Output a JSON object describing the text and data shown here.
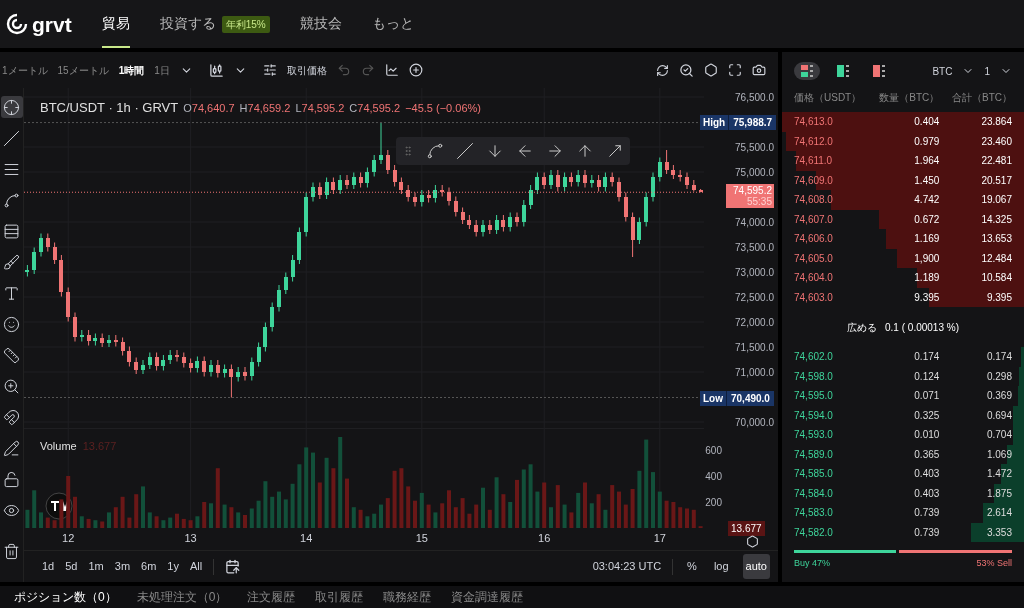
{
  "nav": {
    "logo": "grvt",
    "items": [
      {
        "label": "貿易",
        "selected": true
      },
      {
        "label": "投資する",
        "selected": false,
        "badge": "年利15%"
      },
      {
        "label": "競技会",
        "selected": false
      },
      {
        "label": "もっと",
        "selected": false
      }
    ]
  },
  "toolbar": {
    "intervals": [
      {
        "label": "1メートル",
        "selected": false
      },
      {
        "label": "15メートル",
        "selected": false
      },
      {
        "label": "1時間",
        "selected": true
      },
      {
        "label": "1日",
        "selected": false
      }
    ],
    "price_source": "取引価格"
  },
  "tools": [
    {
      "kind": "crosshair",
      "selected": true
    },
    {
      "kind": "line",
      "selected": false
    },
    {
      "kind": "fib",
      "selected": false
    },
    {
      "kind": "pattern",
      "selected": false
    },
    {
      "kind": "channel",
      "selected": false
    },
    {
      "kind": "brush",
      "selected": false
    },
    {
      "kind": "text",
      "selected": false
    },
    {
      "kind": "emoji",
      "selected": false
    },
    {
      "kind": "ruler",
      "selected": false
    },
    {
      "kind": "zoom",
      "selected": false
    },
    {
      "kind": "magnet",
      "selected": false
    },
    {
      "kind": "lockdraw",
      "selected": false
    },
    {
      "kind": "lock",
      "selected": false
    },
    {
      "kind": "eye",
      "selected": false
    },
    {
      "kind": "trash",
      "selected": false
    }
  ],
  "legend": {
    "symbol": "BTC/USDT · 1h · GRVT",
    "ohlc": [
      {
        "label": "O",
        "value": "74,640.7"
      },
      {
        "label": "H",
        "value": "74,659.2"
      },
      {
        "label": "L",
        "value": "74,595.2"
      },
      {
        "label": "C",
        "value": "74,595.2"
      }
    ],
    "change": "−45.5 (−0.06%)"
  },
  "price_chart": {
    "high": {
      "label": "High",
      "value": "75,988.7"
    },
    "low": {
      "label": "Low",
      "value": "70,490.0"
    },
    "current": {
      "value": "74,595.2",
      "countdown": "55:35"
    },
    "chart_data": {
      "type": "candlestick",
      "ylim": [
        70000,
        76500
      ],
      "grid": true,
      "yticks": [
        {
          "value": 76500,
          "label": "76,500.0"
        },
        {
          "value": 75500,
          "label": "75,500.0"
        },
        {
          "value": 75000,
          "label": "75,000.0"
        },
        {
          "value": 74000,
          "label": "74,000.0"
        },
        {
          "value": 73500,
          "label": "73,500.0"
        },
        {
          "value": 73000,
          "label": "73,000.0"
        },
        {
          "value": 72500,
          "label": "72,500.0"
        },
        {
          "value": 72000,
          "label": "72,000.0"
        },
        {
          "value": 71500,
          "label": "71,500.0"
        },
        {
          "value": 71000,
          "label": "71,000.0"
        },
        {
          "value": 70000,
          "label": "70,000.0"
        }
      ],
      "categories": [
        null,
        null,
        null,
        null,
        null,
        null,
        null,
        null,
        null,
        null,
        null,
        null,
        null,
        null,
        null,
        null,
        null,
        null,
        null,
        null,
        null,
        null,
        null,
        null,
        null,
        null,
        null,
        null,
        null,
        null,
        null,
        null,
        null,
        null,
        null,
        null,
        null,
        null,
        null,
        null,
        null,
        null,
        null,
        null,
        null,
        null,
        null,
        null,
        null,
        null,
        null,
        null,
        null,
        null,
        null,
        null,
        null,
        null,
        null,
        null,
        null,
        null,
        null,
        null,
        null,
        null,
        null,
        null,
        null,
        null,
        null,
        null,
        null,
        null,
        null,
        null,
        null,
        null,
        null,
        null,
        null,
        null,
        null,
        null,
        null,
        null,
        null,
        null,
        null,
        null,
        null,
        null,
        null,
        null,
        null,
        null,
        null,
        null,
        null,
        null
      ],
      "ohlc": [
        [
          73000,
          73140,
          72910,
          73050
        ],
        [
          73050,
          73490,
          72960,
          73400
        ],
        [
          73400,
          73770,
          73310,
          73680
        ],
        [
          73680,
          73770,
          73410,
          73500
        ],
        [
          73500,
          73590,
          73160,
          73250
        ],
        [
          73250,
          73340,
          72510,
          72600
        ],
        [
          72600,
          72690,
          72010,
          72100
        ],
        [
          72100,
          72190,
          71610,
          71700
        ],
        [
          71700,
          71840,
          71610,
          71750
        ],
        [
          71750,
          71840,
          71530,
          71620
        ],
        [
          71620,
          71770,
          71530,
          71680
        ],
        [
          71680,
          71770,
          71500,
          71590
        ],
        [
          71590,
          71740,
          71500,
          71650
        ],
        [
          71650,
          71740,
          71510,
          71600
        ],
        [
          71600,
          71690,
          71330,
          71420
        ],
        [
          71420,
          71510,
          71110,
          71200
        ],
        [
          71200,
          71290,
          70960,
          71050
        ],
        [
          71050,
          71240,
          70960,
          71150
        ],
        [
          71150,
          71390,
          71060,
          71300
        ],
        [
          71300,
          71390,
          71030,
          71120
        ],
        [
          71120,
          71340,
          71030,
          71250
        ],
        [
          71250,
          71440,
          71160,
          71350
        ],
        [
          71350,
          71440,
          71210,
          71300
        ],
        [
          71300,
          71390,
          71090,
          71180
        ],
        [
          71180,
          71270,
          70990,
          71080
        ],
        [
          71080,
          71310,
          70990,
          71220
        ],
        [
          71220,
          71310,
          70910,
          71000
        ],
        [
          71000,
          71240,
          70910,
          71150
        ],
        [
          71150,
          71240,
          70890,
          70980
        ],
        [
          70980,
          71150,
          70890,
          71060
        ],
        [
          71060,
          71150,
          70490,
          70900
        ],
        [
          70900,
          71100,
          70810,
          71010
        ],
        [
          71010,
          71100,
          70830,
          70920
        ],
        [
          70920,
          71290,
          70830,
          71200
        ],
        [
          71200,
          71590,
          71110,
          71500
        ],
        [
          71500,
          71990,
          71410,
          71900
        ],
        [
          71900,
          72390,
          71810,
          72300
        ],
        [
          72300,
          72740,
          72210,
          72650
        ],
        [
          72650,
          72990,
          72560,
          72900
        ],
        [
          72900,
          73340,
          72810,
          73250
        ],
        [
          73250,
          73890,
          73160,
          73800
        ],
        [
          73800,
          74590,
          73710,
          74500
        ],
        [
          74500,
          74790,
          74410,
          74700
        ],
        [
          74700,
          74790,
          74460,
          74550
        ],
        [
          74550,
          74890,
          74460,
          74800
        ],
        [
          74800,
          74890,
          74560,
          74650
        ],
        [
          74650,
          74940,
          74560,
          74850
        ],
        [
          74850,
          74940,
          74660,
          74750
        ],
        [
          74750,
          74990,
          74660,
          74900
        ],
        [
          74900,
          74990,
          74690,
          74780
        ],
        [
          74780,
          75090,
          74690,
          75000
        ],
        [
          75000,
          75340,
          74910,
          75250
        ],
        [
          75250,
          75990,
          75160,
          75350
        ],
        [
          75350,
          75440,
          74960,
          75050
        ],
        [
          75050,
          75140,
          74710,
          74800
        ],
        [
          74800,
          74890,
          74560,
          74650
        ],
        [
          74650,
          74740,
          74410,
          74500
        ],
        [
          74500,
          74590,
          74310,
          74400
        ],
        [
          74400,
          74640,
          74310,
          74550
        ],
        [
          74550,
          74640,
          74390,
          74480
        ],
        [
          74480,
          74740,
          74390,
          74650
        ],
        [
          74650,
          74740,
          74510,
          74600
        ],
        [
          74600,
          74690,
          74330,
          74420
        ],
        [
          74420,
          74510,
          74110,
          74200
        ],
        [
          74200,
          74290,
          73960,
          74050
        ],
        [
          74050,
          74140,
          73860,
          73950
        ],
        [
          73950,
          74040,
          73710,
          73800
        ],
        [
          73800,
          74040,
          73710,
          73950
        ],
        [
          73950,
          74040,
          73760,
          73850
        ],
        [
          73850,
          74140,
          73760,
          74050
        ],
        [
          74050,
          74140,
          73810,
          73900
        ],
        [
          73900,
          74190,
          73810,
          74100
        ],
        [
          74100,
          74190,
          73910,
          74000
        ],
        [
          74000,
          74440,
          73910,
          74350
        ],
        [
          74350,
          74740,
          74260,
          74650
        ],
        [
          74650,
          74990,
          74560,
          74900
        ],
        [
          74900,
          74990,
          74660,
          74750
        ],
        [
          74750,
          75040,
          74660,
          74950
        ],
        [
          74950,
          75040,
          74610,
          74700
        ],
        [
          74700,
          74990,
          74610,
          74900
        ],
        [
          74900,
          74990,
          74710,
          74800
        ],
        [
          74800,
          75040,
          74710,
          74950
        ],
        [
          74950,
          75040,
          74690,
          74780
        ],
        [
          74780,
          74940,
          74690,
          74850
        ],
        [
          74850,
          74940,
          74610,
          74700
        ],
        [
          74700,
          74990,
          74610,
          74900
        ],
        [
          74900,
          74990,
          74710,
          74800
        ],
        [
          74800,
          74890,
          74410,
          74500
        ],
        [
          74500,
          74590,
          74010,
          74100
        ],
        [
          74100,
          74190,
          73300,
          73650
        ],
        [
          73650,
          74090,
          73560,
          74000
        ],
        [
          74000,
          74590,
          73910,
          74500
        ],
        [
          74500,
          74990,
          74410,
          74900
        ],
        [
          74900,
          75290,
          74810,
          75200
        ],
        [
          75200,
          75440,
          74960,
          75050
        ],
        [
          75050,
          75140,
          74860,
          74950
        ],
        [
          74950,
          75040,
          74810,
          74900
        ],
        [
          74900,
          74990,
          74660,
          74750
        ],
        [
          74750,
          74840,
          74610,
          74640
        ],
        [
          74640,
          74660,
          74595,
          74595
        ]
      ]
    }
  },
  "volume": {
    "label": "Volume",
    "value": "13.677",
    "current": "13.677",
    "chart_data": {
      "type": "bar",
      "ylim": [
        0,
        720
      ],
      "grid": true,
      "yticks": [
        {
          "value": 600,
          "label": "600"
        },
        {
          "value": 400,
          "label": "400"
        },
        {
          "value": 200,
          "label": "200"
        }
      ],
      "categories": [
        null,
        null,
        null,
        null,
        null,
        null,
        "12",
        null,
        null,
        null,
        null,
        null,
        null,
        null,
        null,
        null,
        null,
        null,
        null,
        null,
        null,
        null,
        null,
        null,
        "13",
        null,
        null,
        null,
        null,
        null,
        null,
        null,
        null,
        null,
        null,
        null,
        null,
        null,
        null,
        null,
        null,
        "14",
        null,
        null,
        null,
        null,
        null,
        null,
        null,
        null,
        null,
        null,
        null,
        null,
        null,
        null,
        null,
        null,
        "15",
        null,
        null,
        null,
        null,
        null,
        null,
        null,
        null,
        null,
        null,
        null,
        null,
        null,
        null,
        null,
        null,
        null,
        "16",
        null,
        null,
        null,
        null,
        null,
        null,
        null,
        null,
        null,
        null,
        null,
        null,
        null,
        null,
        null,
        null,
        "17",
        null,
        null,
        null,
        null,
        null,
        null
      ],
      "values": [
        140,
        290,
        120,
        80,
        60,
        220,
        400,
        240,
        90,
        70,
        60,
        50,
        120,
        160,
        240,
        80,
        260,
        320,
        120,
        90,
        60,
        80,
        110,
        70,
        60,
        90,
        200,
        190,
        460,
        180,
        160,
        120,
        100,
        150,
        210,
        360,
        240,
        280,
        220,
        340,
        490,
        620,
        580,
        350,
        540,
        460,
        700,
        380,
        160,
        140,
        90,
        110,
        180,
        230,
        440,
        460,
        320,
        210,
        270,
        180,
        120,
        190,
        290,
        160,
        230,
        110,
        180,
        310,
        140,
        390,
        260,
        200,
        370,
        450,
        490,
        280,
        350,
        160,
        330,
        180,
        120,
        270,
        350,
        190,
        260,
        140,
        330,
        280,
        180,
        300,
        440,
        680,
        430,
        280,
        210,
        200,
        160,
        150,
        140,
        14
      ]
    }
  },
  "ranges": [
    "1d",
    "5d",
    "1m",
    "3m",
    "6m",
    "1y",
    "All"
  ],
  "chart_footer": {
    "time": "03:04:23 UTC",
    "options": [
      {
        "label": "%",
        "selected": false
      },
      {
        "label": "log",
        "selected": false
      },
      {
        "label": "auto",
        "selected": true
      }
    ]
  },
  "orderbook": {
    "views": [
      {
        "kind": "both",
        "selected": true
      },
      {
        "kind": "bids",
        "selected": false
      },
      {
        "kind": "asks",
        "selected": false
      }
    ],
    "asset": "BTC",
    "step": "1",
    "columns": [
      "価格（USDT）",
      "数量（BTC）",
      "合計（BTC）"
    ],
    "asks": [
      [
        "74,613.0",
        "0.404",
        "23.864"
      ],
      [
        "74,612.0",
        "0.979",
        "23.460"
      ],
      [
        "74,611.0",
        "1.964",
        "22.481"
      ],
      [
        "74,609.0",
        "1.450",
        "20.517"
      ],
      [
        "74,608.0",
        "4.742",
        "19.067"
      ],
      [
        "74,607.0",
        "0.672",
        "14.325"
      ],
      [
        "74,606.0",
        "1.169",
        "13.653"
      ],
      [
        "74,605.0",
        "1,900",
        "12.484"
      ],
      [
        "74,604.0",
        "1.189",
        "10.584"
      ],
      [
        "74,603.0",
        "9.395",
        "9.395"
      ]
    ],
    "spread_label": "広める",
    "spread": "0.1 ( 0.00013 %)",
    "bids": [
      [
        "74,602.0",
        "0.174",
        "0.174"
      ],
      [
        "74,598.0",
        "0.124",
        "0.298"
      ],
      [
        "74,595.0",
        "0.071",
        "0.369"
      ],
      [
        "74,594.0",
        "0.325",
        "0.694"
      ],
      [
        "74,593.0",
        "0.010",
        "0.704"
      ],
      [
        "74,589.0",
        "0.365",
        "1.069"
      ],
      [
        "74,585.0",
        "0.403",
        "1.472"
      ],
      [
        "74,584.0",
        "0.403",
        "1.875"
      ],
      [
        "74,583.0",
        "0.739",
        "2.614"
      ],
      [
        "74,582.0",
        "0.739",
        "3.353"
      ]
    ],
    "buy_label": "Buy 47%",
    "sell_label": "53% Sell",
    "level": 0.47
  },
  "bottom_tabs": [
    {
      "label": "ポジション数（0）",
      "selected": true
    },
    {
      "label": "未処理注文（0）",
      "selected": false
    },
    {
      "label": "注文履歴",
      "selected": false
    },
    {
      "label": "取引履歴",
      "selected": false
    },
    {
      "label": "職務経歴",
      "selected": false
    },
    {
      "label": "資金調達履歴",
      "selected": false
    }
  ]
}
